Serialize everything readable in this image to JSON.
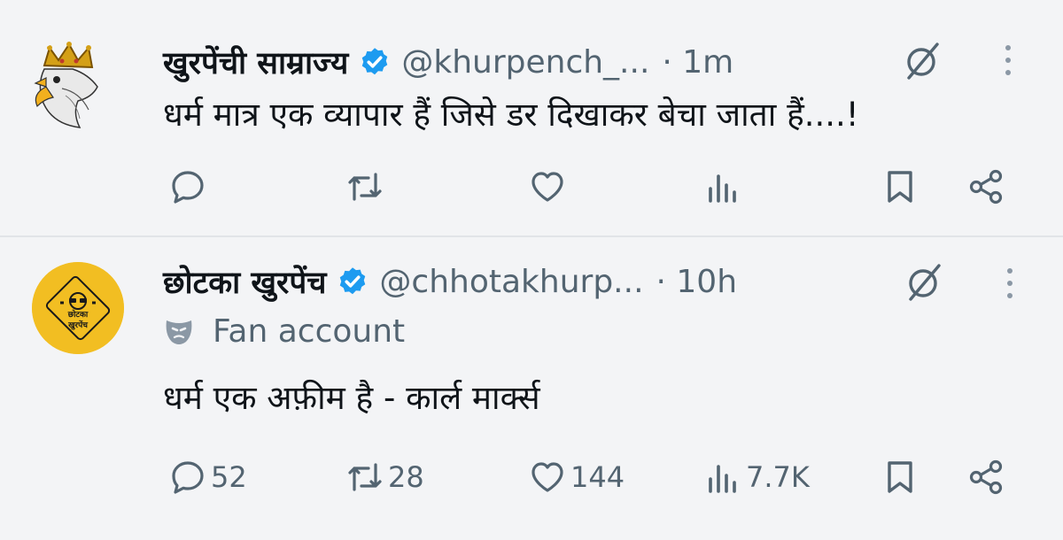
{
  "tweets": [
    {
      "display_name": "खुरपेंची साम्राज्य",
      "handle": "@khurpench_...",
      "time": "· 1m",
      "text": "धर्म मात्र एक व्यापार हैं जिसे डर दिखाकर बेचा जाता हैं....!",
      "counts": {
        "reply": "",
        "retweet": "",
        "like": "",
        "views": ""
      }
    },
    {
      "display_name": "छोटका खुरपेंच",
      "handle": "@chhotakhurp...",
      "time": "· 10h",
      "label": "Fan account",
      "avatar_text_1": "छोटका",
      "avatar_text_2": "खुरपेंच",
      "text": "धर्म एक अफ़ीम है - कार्ल मार्क्स",
      "counts": {
        "reply": "52",
        "retweet": "28",
        "like": "144",
        "views": "7.7K"
      }
    }
  ],
  "colors": {
    "background": "#f3f4f6",
    "verified": "#1d9bf0",
    "secondary_text": "#536471",
    "avatar_yellow": "#f2be22"
  },
  "icons": [
    "verified-badge-icon",
    "grok-icon",
    "more-icon",
    "reply-icon",
    "retweet-icon",
    "like-icon",
    "views-icon",
    "bookmark-icon",
    "share-icon",
    "fan-mask-icon"
  ]
}
